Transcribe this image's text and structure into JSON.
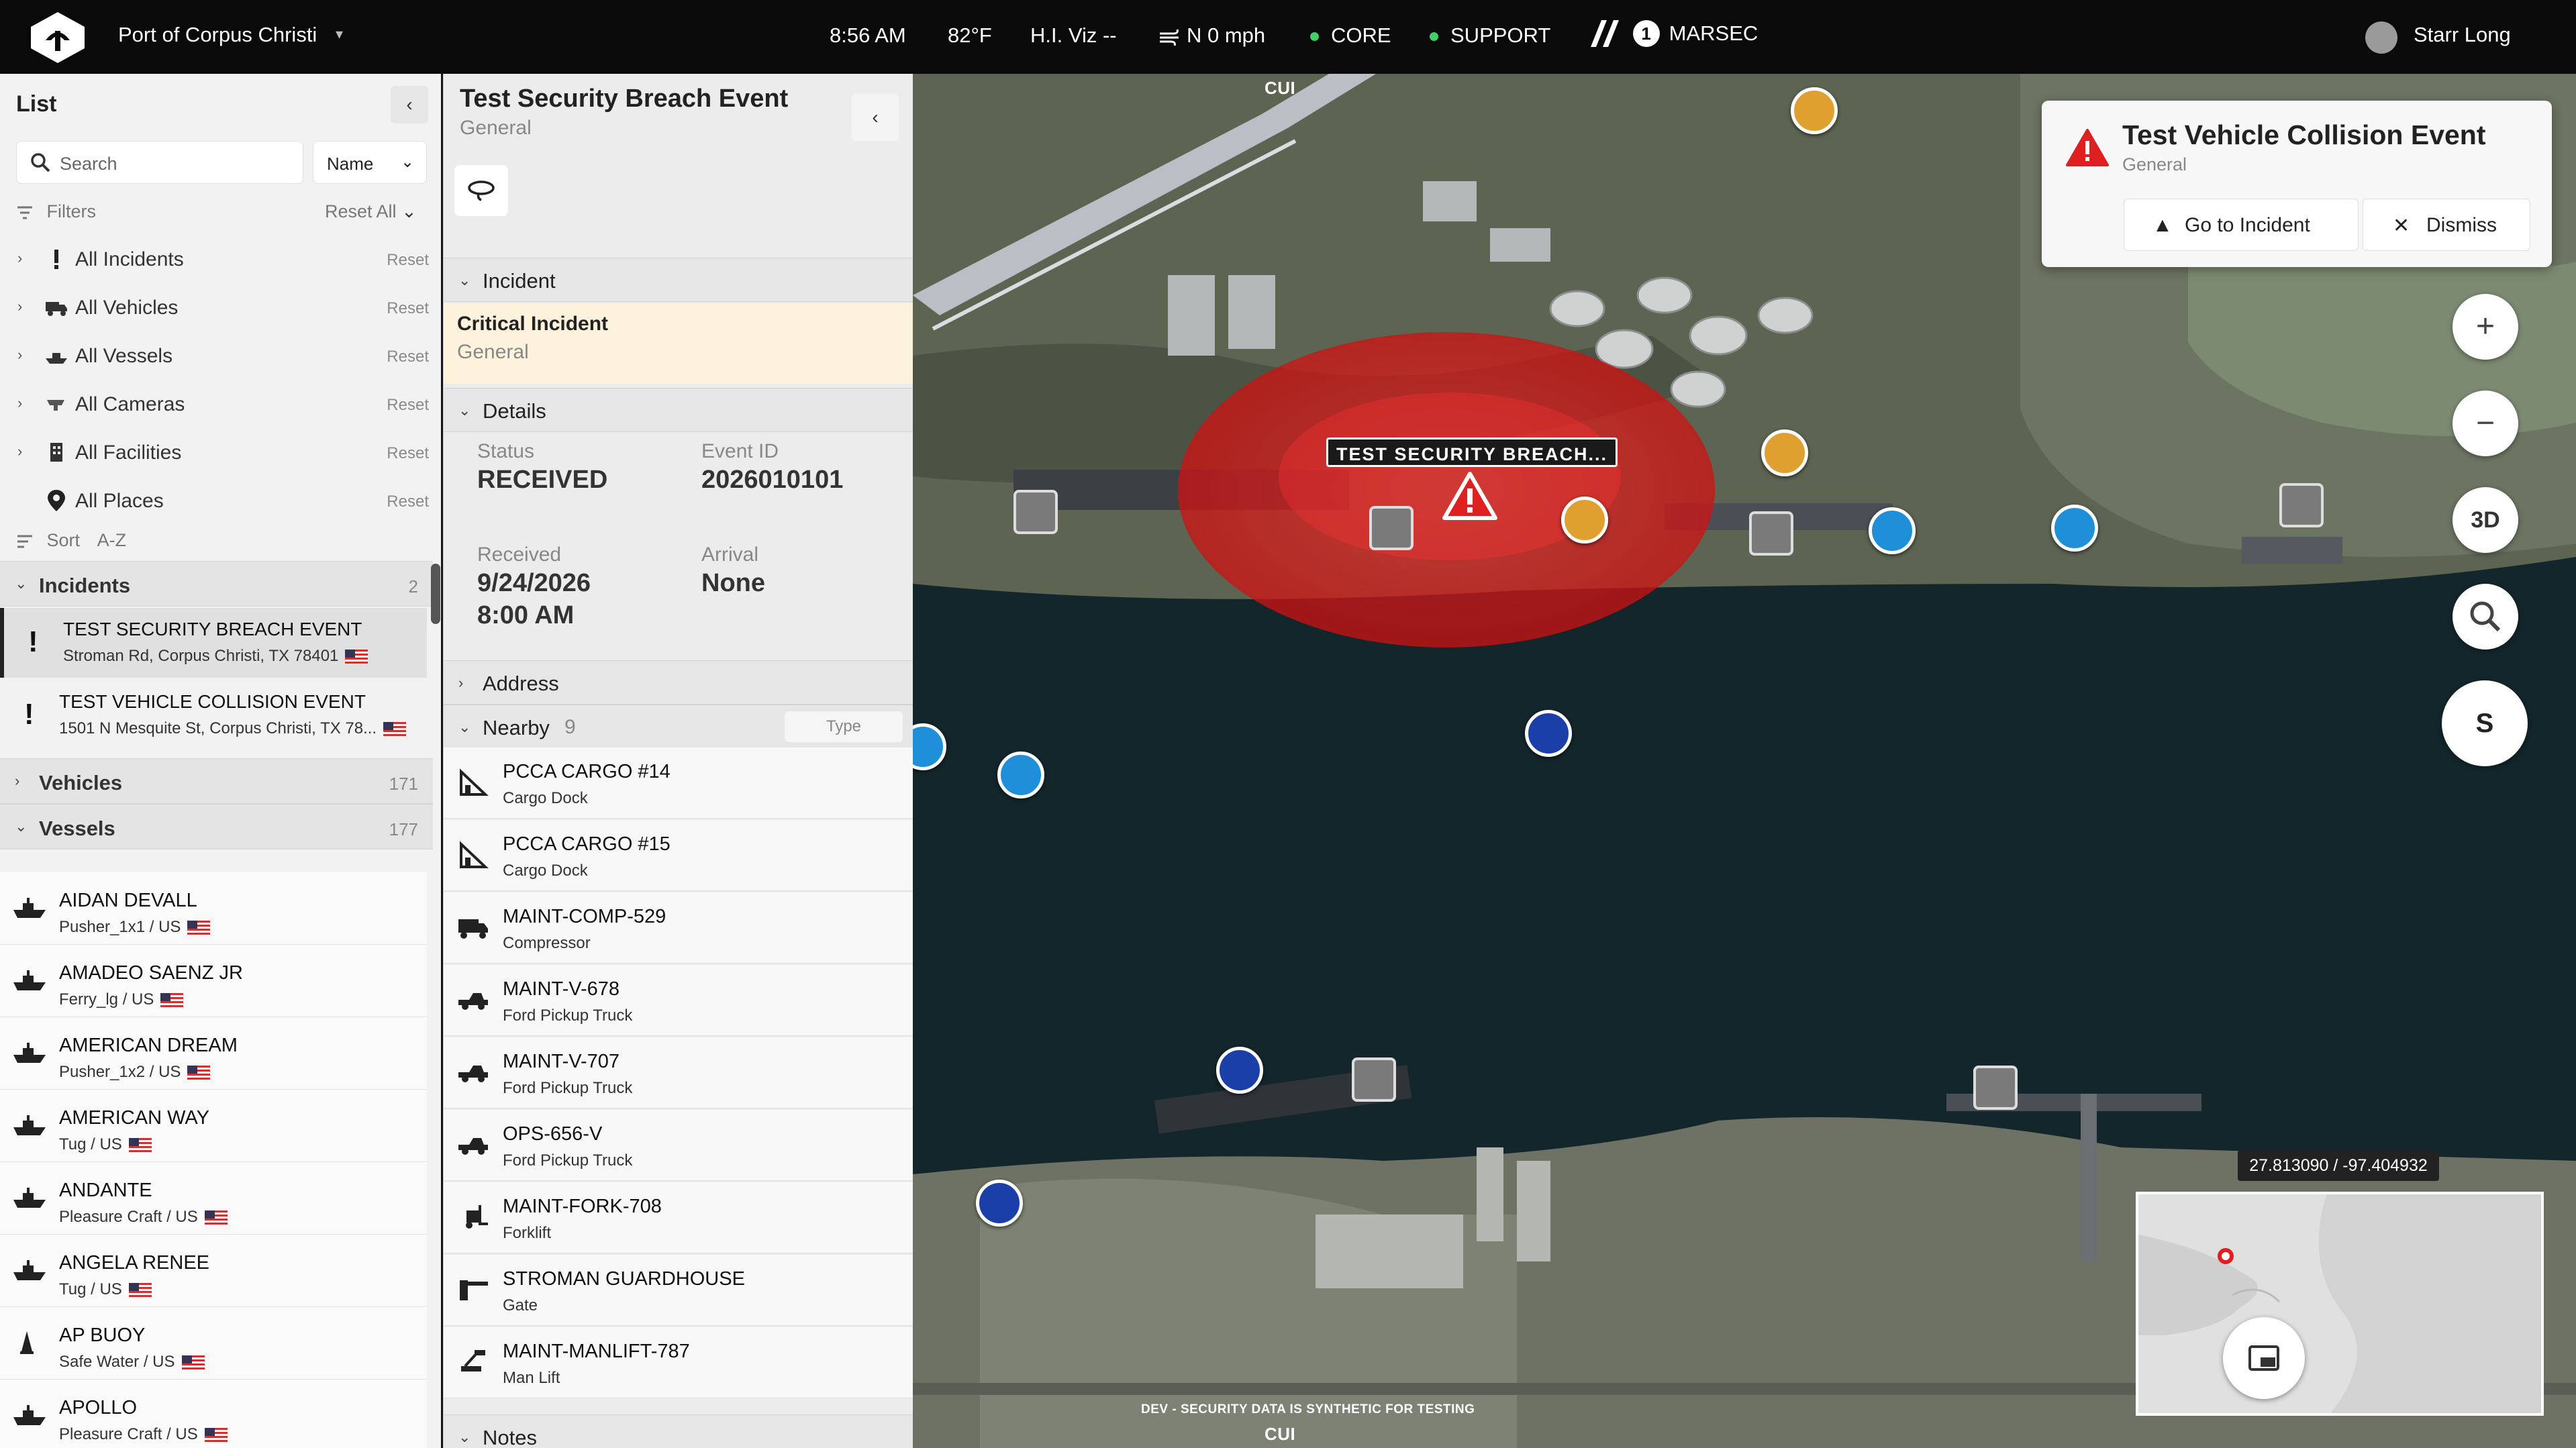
{
  "topbar": {
    "port": "Port of Corpus Christi",
    "time": "8:56 AM",
    "temp": "82°F",
    "hviz": "H.I. Viz --",
    "wind": "N 0 mph",
    "status1": "CORE",
    "status2": "SUPPORT",
    "marsec_level": "1",
    "marsec": "MARSEC",
    "user": "Starr Long",
    "colors": {
      "bg": "#0a0a0a",
      "status_ok": "#3fd06a"
    }
  },
  "list": {
    "title": "List",
    "search_placeholder": "Search",
    "sort_select": "Name",
    "filters_label": "Filters",
    "reset_all": "Reset All",
    "filters": [
      {
        "label": "All Incidents",
        "reset": "Reset",
        "icon": "exclamation-icon"
      },
      {
        "label": "All Vehicles",
        "reset": "Reset",
        "icon": "truck-icon"
      },
      {
        "label": "All Vessels",
        "reset": "Reset",
        "icon": "ship-icon"
      },
      {
        "label": "All Cameras",
        "reset": "Reset",
        "icon": "camera-icon"
      },
      {
        "label": "All Facilities",
        "reset": "Reset",
        "icon": "building-icon"
      },
      {
        "label": "All Places",
        "reset": "Reset",
        "icon": "location-pin-icon"
      }
    ],
    "sort_label": "Sort",
    "sort_value": "A-Z",
    "sections": {
      "incidents": {
        "label": "Incidents",
        "count": "2"
      },
      "vehicles": {
        "label": "Vehicles",
        "count": "171"
      },
      "vessels": {
        "label": "Vessels",
        "count": "177"
      }
    },
    "incidents": [
      {
        "title": "TEST SECURITY BREACH EVENT",
        "address": "Stroman Rd, Corpus Christi, TX 78401"
      },
      {
        "title": "TEST VEHICLE COLLISION EVENT",
        "address": "1501 N Mesquite St, Corpus Christi, TX 78..."
      }
    ],
    "vessels": [
      {
        "name": "AIDAN DEVALL",
        "sub": "Pusher_1x1 / US"
      },
      {
        "name": "AMADEO SAENZ JR",
        "sub": "Ferry_lg / US"
      },
      {
        "name": "AMERICAN DREAM",
        "sub": "Pusher_1x2 / US"
      },
      {
        "name": "AMERICAN WAY",
        "sub": "Tug / US"
      },
      {
        "name": "ANDANTE",
        "sub": "Pleasure Craft / US"
      },
      {
        "name": "ANGELA RENEE",
        "sub": "Tug / US"
      },
      {
        "name": "AP BUOY",
        "sub": "Safe Water / US"
      },
      {
        "name": "APOLLO",
        "sub": "Pleasure Craft / US"
      }
    ]
  },
  "detail": {
    "title": "Test Security Breach Event",
    "subtitle": "General",
    "section_incident": "Incident",
    "critical_title": "Critical Incident",
    "critical_sub": "General",
    "section_details": "Details",
    "status_label": "Status",
    "status_value": "RECEIVED",
    "event_id_label": "Event ID",
    "event_id_value": "2026010101",
    "received_label": "Received",
    "received_date": "9/24/2026",
    "received_time": "8:00 AM",
    "arrival_label": "Arrival",
    "arrival_value": "None",
    "section_address": "Address",
    "section_nearby": "Nearby",
    "nearby_count": "9",
    "type_button": "Type",
    "section_notes": "Notes",
    "nearby": [
      {
        "title": "PCCA CARGO #14",
        "sub": "Cargo Dock",
        "icon": "dock-icon"
      },
      {
        "title": "PCCA CARGO #15",
        "sub": "Cargo Dock",
        "icon": "dock-icon"
      },
      {
        "title": "MAINT-COMP-529",
        "sub": "Compressor",
        "icon": "compressor-truck-icon"
      },
      {
        "title": "MAINT-V-678",
        "sub": "Ford Pickup Truck",
        "icon": "pickup-truck-icon"
      },
      {
        "title": "MAINT-V-707",
        "sub": "Ford Pickup Truck",
        "icon": "pickup-truck-icon"
      },
      {
        "title": "OPS-656-V",
        "sub": "Ford Pickup Truck",
        "icon": "pickup-truck-icon"
      },
      {
        "title": "MAINT-FORK-708",
        "sub": "Forklift",
        "icon": "forklift-icon"
      },
      {
        "title": "STROMAN GUARDHOUSE",
        "sub": "Gate",
        "icon": "gate-icon"
      },
      {
        "title": "MAINT-MANLIFT-787",
        "sub": "Man Lift",
        "icon": "man-lift-icon"
      }
    ],
    "colors": {
      "critical_bg": "#fdf3dd"
    }
  },
  "map": {
    "breach_label": "TEST SECURITY BREACH...",
    "cui_label": "CUI",
    "dev_notice": "DEV - SECURITY DATA IS SYNTHETIC FOR TESTING",
    "coords": "27.813090 / -97.404932",
    "compass": "S",
    "btn_3d": "3D",
    "zoom_in": "+",
    "zoom_out": "−",
    "toast": {
      "title": "Test Vehicle Collision Event",
      "subtitle": "General",
      "go": "Go to Incident",
      "dismiss": "Dismiss"
    },
    "colors": {
      "alert_red": "#e02020",
      "vessel_blue": "#1e8fd8",
      "police_blue": "#1a3fa8",
      "orange": "#e0a030"
    }
  }
}
